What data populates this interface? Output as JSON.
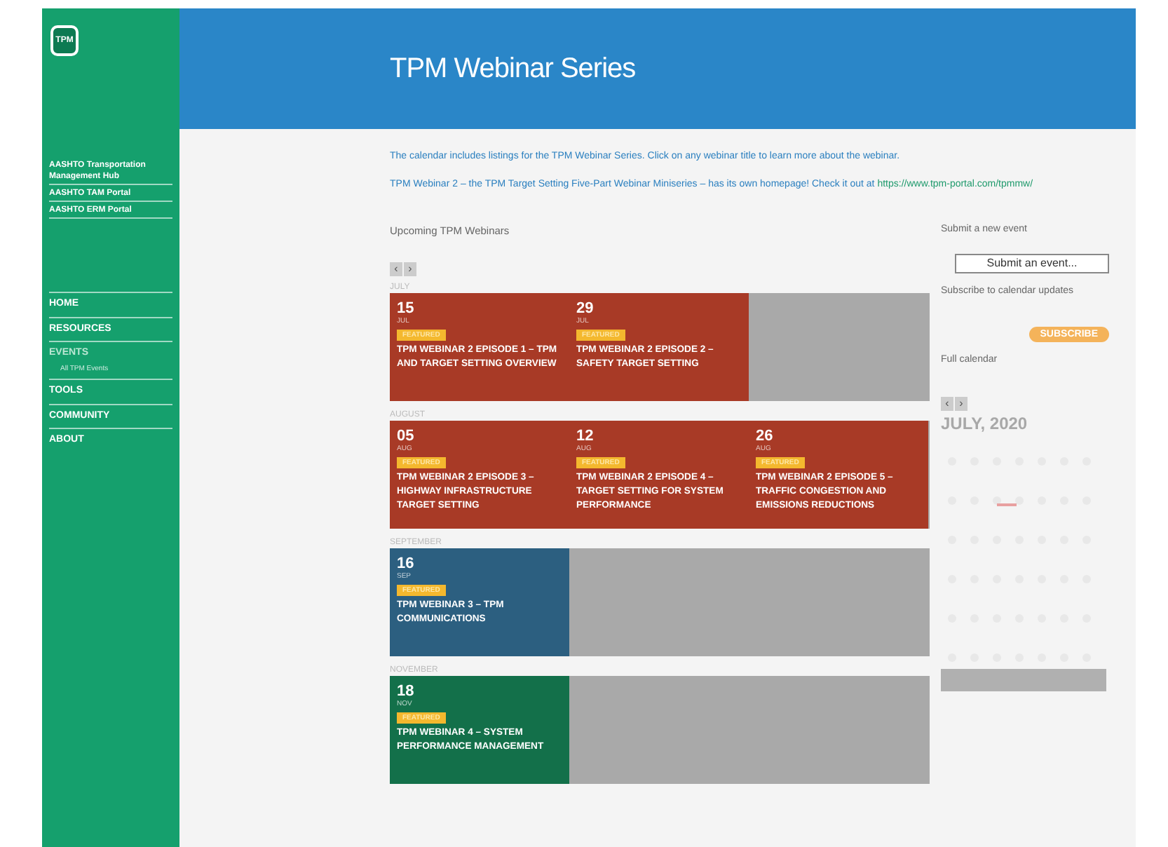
{
  "sidebar": {
    "logo": "TPM",
    "links": [
      "AASHTO Transportation Management Hub",
      "AASHTO TAM Portal",
      "AASHTO ERM Portal"
    ],
    "nav": [
      {
        "label": "HOME",
        "selected": false
      },
      {
        "label": "RESOURCES",
        "selected": false
      },
      {
        "label": "EVENTS",
        "selected": true,
        "children": [
          {
            "label": "All TPM Events"
          }
        ]
      },
      {
        "label": "TOOLS",
        "selected": false
      },
      {
        "label": "COMMUNITY",
        "selected": false
      },
      {
        "label": "ABOUT",
        "selected": false
      }
    ]
  },
  "header": {
    "title": "TPM Webinar Series"
  },
  "intro": "The calendar includes listings for the TPM Webinar Series. Click on any webinar title to learn more about the webinar.",
  "notice": {
    "text": "TPM Webinar 2 – the TPM Target Setting Five-Part Webinar Miniseries – has its own homepage! Check it out at ",
    "link": "https://www.tpm-portal.com/tpmmw/"
  },
  "upcoming": {
    "heading": "Upcoming TPM Webinars",
    "pager": [
      "‹",
      "›"
    ],
    "months": [
      {
        "name": "JULY",
        "color": "#a83a26",
        "events": [
          {
            "day": "15",
            "month": "JUL",
            "badge": "FEATURED",
            "title": "TPM WEBINAR 2 EPISODE 1 – TPM AND TARGET SETTING OVERVIEW"
          },
          {
            "day": "29",
            "month": "JUL",
            "badge": "FEATURED",
            "title": "TPM WEBINAR 2 EPISODE 2 – SAFETY TARGET SETTING"
          }
        ]
      },
      {
        "name": "AUGUST",
        "color": "#a83a26",
        "events": [
          {
            "day": "05",
            "month": "AUG",
            "badge": "FEATURED",
            "title": "TPM WEBINAR 2 EPISODE 3 – HIGHWAY INFRASTRUCTURE TARGET SETTING"
          },
          {
            "day": "12",
            "month": "AUG",
            "badge": "FEATURED",
            "title": "TPM WEBINAR 2 EPISODE 4 – TARGET SETTING FOR SYSTEM PERFORMANCE"
          },
          {
            "day": "26",
            "month": "AUG",
            "badge": "FEATURED",
            "title": "TPM WEBINAR 2 EPISODE 5 – TRAFFIC CONGESTION AND EMISSIONS REDUCTIONS"
          }
        ]
      },
      {
        "name": "SEPTEMBER",
        "color": "#2c5f80",
        "events": [
          {
            "day": "16",
            "month": "SEP",
            "badge": "FEATURED",
            "title": "TPM WEBINAR 3 – TPM COMMUNICATIONS"
          }
        ]
      },
      {
        "name": "NOVEMBER",
        "color": "#13704a",
        "events": [
          {
            "day": "18",
            "month": "NOV",
            "badge": "FEATURED",
            "title": "TPM WEBINAR 4 – SYSTEM PERFORMANCE MANAGEMENT"
          }
        ]
      }
    ]
  },
  "aside": {
    "submit_label": "Submit a new event",
    "submit_button": "Submit an event...",
    "subscribe_label": "Subscribe to calendar updates",
    "subscribe_button": "SUBSCRIBE",
    "calendar_label": "Full calendar",
    "calendar_pager": [
      "‹",
      "›"
    ],
    "calendar_month": "JULY, 2020"
  }
}
